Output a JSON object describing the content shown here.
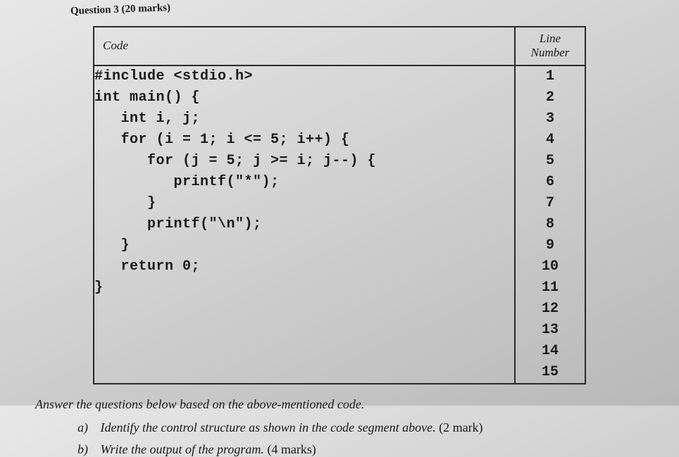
{
  "question_header": "Question 3 (20 marks)",
  "table": {
    "code_header": "Code",
    "line_header_l1": "Line",
    "line_header_l2": "Number",
    "code_lines": [
      "#include <stdio.h>",
      "",
      "int main() {",
      "   int i, j;",
      "",
      "   for (i = 1; i <= 5; i++) {",
      "",
      "      for (j = 5; j >= i; j--) {",
      "         printf(\"*\");",
      "      }",
      "",
      "      printf(\"\\n\");",
      "   }",
      "   return 0;",
      "}"
    ],
    "line_numbers": [
      "1",
      "2",
      "3",
      "4",
      "5",
      "6",
      "7",
      "8",
      "9",
      "10",
      "11",
      "12",
      "13",
      "14",
      "15"
    ]
  },
  "instructions": "Answer the questions below based on the above-mentioned code.",
  "questions": [
    {
      "label": "a)",
      "text": "Identify the control structure as shown in the code segment above.",
      "marks": "(2 mark)"
    },
    {
      "label": "b)",
      "text": "Write the output of the program.",
      "marks": "(4 marks)"
    }
  ]
}
